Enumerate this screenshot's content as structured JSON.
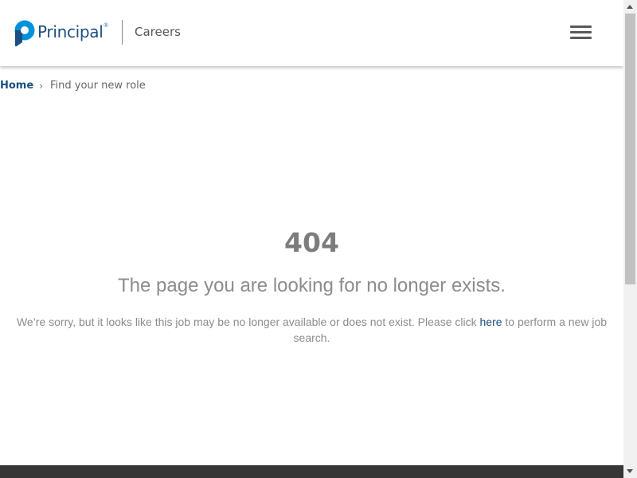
{
  "header": {
    "brand_name": "Principal",
    "brand_reg": "®",
    "section": "Careers",
    "menu_icon": "hamburger-menu-icon",
    "logo_icon": "principal-logo-mark-icon",
    "brand_color": "#1b4f80",
    "logo_mark_colors": [
      "#0091da",
      "#1b4f80"
    ]
  },
  "breadcrumb": {
    "home": "Home",
    "separator": "›",
    "current": "Find your new role"
  },
  "error": {
    "code": "404",
    "title": "The page you are looking for no longer exists.",
    "message_before": "We’re sorry, but it looks like this job may be no longer available or does not exist. Please click ",
    "link_text": "here",
    "message_after": " to perform a new job search."
  },
  "footer": {
    "band_color": "#363636"
  },
  "scrollbar": {
    "thumb_color": "#c1c1c1",
    "track_color": "#f1f1f1"
  }
}
